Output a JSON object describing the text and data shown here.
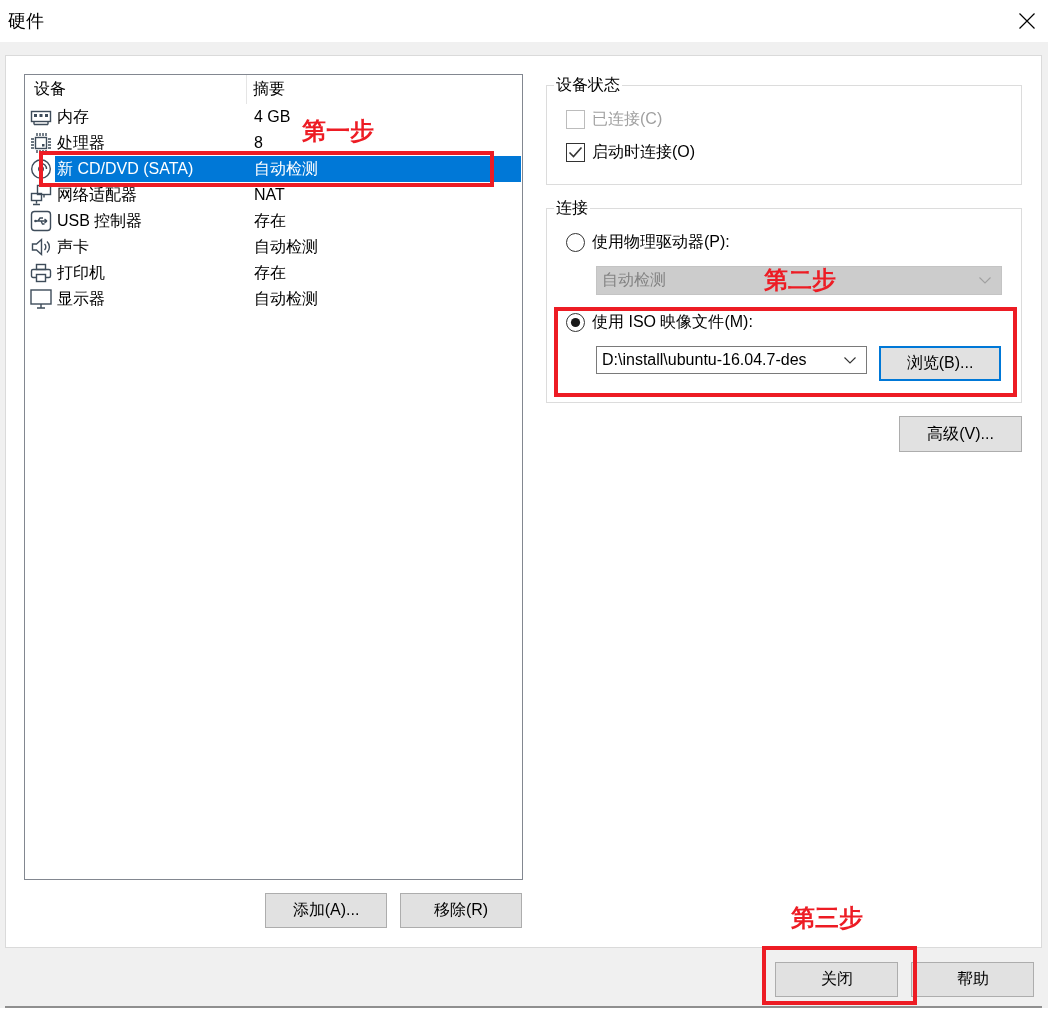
{
  "window": {
    "title": "硬件"
  },
  "devices": {
    "columns": [
      "设备",
      "摘要"
    ],
    "rows": [
      {
        "kind": "memory",
        "name": "内存",
        "summary": "4 GB",
        "selected": false
      },
      {
        "kind": "cpu",
        "name": "处理器",
        "summary": "8",
        "selected": false
      },
      {
        "kind": "disc",
        "name": "新 CD/DVD (SATA)",
        "summary": "自动检测",
        "selected": true
      },
      {
        "kind": "network",
        "name": "网络适配器",
        "summary": "NAT",
        "selected": false
      },
      {
        "kind": "usb",
        "name": "USB 控制器",
        "summary": "存在",
        "selected": false
      },
      {
        "kind": "sound",
        "name": "声卡",
        "summary": "自动检测",
        "selected": false
      },
      {
        "kind": "printer",
        "name": "打印机",
        "summary": "存在",
        "selected": false
      },
      {
        "kind": "display",
        "name": "显示器",
        "summary": "自动检测",
        "selected": false
      }
    ]
  },
  "list_buttons": [
    "添加(A)...",
    "移除(R)"
  ],
  "device_status": {
    "title": "设备状态",
    "options": [
      {
        "label": "已连接(C)",
        "checked": false,
        "disabled": true
      },
      {
        "label": "启动时连接(O)",
        "checked": true,
        "disabled": false
      }
    ]
  },
  "connection": {
    "title": "连接",
    "physical": {
      "label": "使用物理驱动器(P):",
      "selected": false,
      "drive": {
        "value": "自动检测",
        "disabled": true
      }
    },
    "iso": {
      "label": "使用 ISO 映像文件(M):",
      "selected": true,
      "path": {
        "value": "D:\\install\\ubuntu-16.04.7-des"
      },
      "browse_button": {
        "label": "浏览(B)...",
        "focused": true
      }
    }
  },
  "advanced_button": "高级(V)...",
  "footer_buttons": [
    "关闭",
    "帮助"
  ],
  "annotations": [
    {
      "label": "第一步"
    },
    {
      "label": "第二步"
    },
    {
      "label": "第三步"
    }
  ]
}
